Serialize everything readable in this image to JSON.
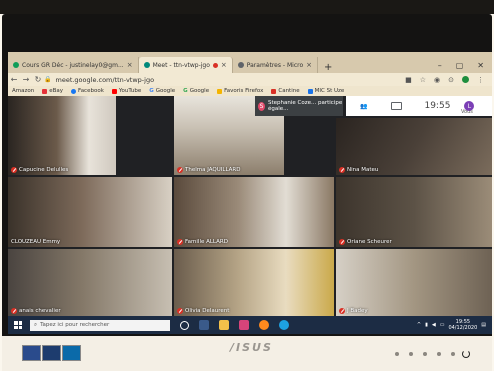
{
  "browser": {
    "tabs": [
      {
        "label": "Cours GR Déc - justinelay0@gm...",
        "icon_color": "#0f9d58",
        "active": false
      },
      {
        "label": "Meet - ttn-vtwp-jgo",
        "icon_color": "#00897b",
        "active": true
      },
      {
        "label": "Paramètres - Micro",
        "icon_color": "#5f6368",
        "active": false
      }
    ],
    "new_tab": "+",
    "window_controls": [
      "–",
      "▢",
      "✕"
    ],
    "url": "meet.google.com/ttn-vtwp-jgo",
    "bookmarks": [
      {
        "label": "Amazon",
        "color": "#222222"
      },
      {
        "label": "eBay",
        "color": "#e53238"
      },
      {
        "label": "Facebook",
        "color": "#1877f2"
      },
      {
        "label": "YouTube",
        "color": "#ff0000"
      },
      {
        "label": "Google",
        "color": "#4285f4"
      },
      {
        "label": "Google",
        "color": "#34a853"
      },
      {
        "label": "Favoris Firefox",
        "color": "#f4b400"
      },
      {
        "label": "Cantine",
        "color": "#d93025"
      },
      {
        "label": "MIC St Uze",
        "color": "#1a73e8"
      }
    ]
  },
  "meet": {
    "notification": {
      "avatar_letter": "S",
      "text": "Stephanie Coze... participe égale..."
    },
    "clock": "19:55",
    "you_avatar": "L",
    "you_label": "Vous",
    "participants": [
      {
        "name": "Capucine Delulles",
        "bg": "#6b5a4a"
      },
      {
        "name": "Thelma JAQUILLARD",
        "bg": "#8c7e6c"
      },
      {
        "name": "Nina Mateu",
        "bg": "#4a4038"
      },
      {
        "name": "CLOUZEAU Emmy",
        "bg": "#7d6a5a"
      },
      {
        "name": "Famille ALLARD",
        "bg": "#9a8a78"
      },
      {
        "name": "Oriane Scheurer",
        "bg": "#5c5246"
      },
      {
        "name": "anais chevalier",
        "bg": "#847868"
      },
      {
        "name": "Olivia Delaurent",
        "bg": "#b5a486"
      },
      {
        "name": "J Badey",
        "bg": "#a39682"
      }
    ]
  },
  "taskbar": {
    "search_placeholder": "Tapez ici pour rechercher",
    "time": "19:55",
    "date": "04/12/2020"
  },
  "monitor": {
    "brand": "/ISUS"
  }
}
